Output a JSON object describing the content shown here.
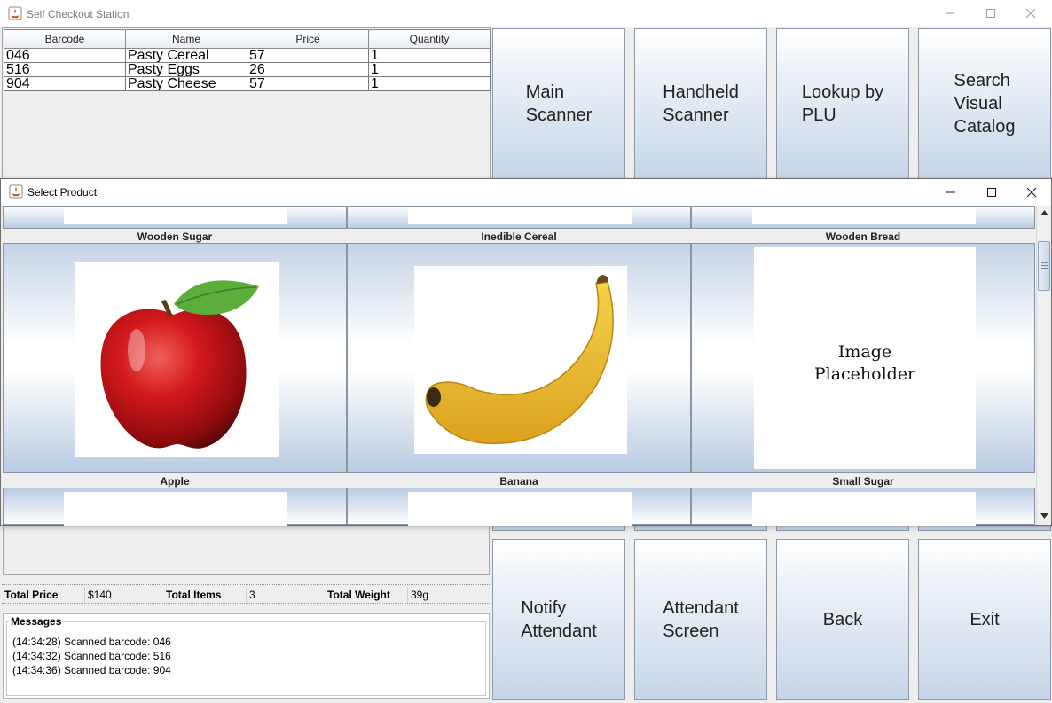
{
  "main_window": {
    "title": "Self Checkout Station",
    "cart": {
      "columns": [
        "Barcode",
        "Name",
        "Price",
        "Quantity"
      ],
      "rows": [
        {
          "barcode": "046",
          "name": "Pasty Cereal",
          "price": "57",
          "quantity": "1"
        },
        {
          "barcode": "516",
          "name": "Pasty Eggs",
          "price": "26",
          "quantity": "1"
        },
        {
          "barcode": "904",
          "name": "Pasty Cheese",
          "price": "57",
          "quantity": "1"
        }
      ]
    },
    "top_buttons": {
      "main_scanner": [
        "Main",
        "Scanner"
      ],
      "handheld_scanner": [
        "Handheld",
        "Scanner"
      ],
      "lookup_plu": [
        "Lookup by",
        "PLU"
      ],
      "search_catalog": [
        "Search",
        "Visual",
        "Catalog"
      ]
    },
    "totals": {
      "price_label": "Total Price",
      "price_value": "$140",
      "items_label": "Total Items",
      "items_value": "3",
      "weight_label": "Total Weight",
      "weight_value": "39g"
    },
    "messages": {
      "legend": "Messages",
      "lines": [
        "(14:34:28) Scanned barcode: 046",
        "(14:34:32) Scanned barcode: 516",
        "(14:34:36) Scanned barcode: 904"
      ]
    },
    "bottom_buttons": {
      "notify_attendant": [
        "Notify",
        "Attendant"
      ],
      "attendant_screen": [
        "Attendant",
        "Screen"
      ],
      "back": [
        "Back"
      ],
      "exit": [
        "Exit"
      ]
    }
  },
  "select_product_window": {
    "title": "Select Product",
    "upper_labels": [
      "Wooden Sugar",
      "Inedible Cereal",
      "Wooden Bread"
    ],
    "products": [
      {
        "name": "Apple",
        "image": "apple-image"
      },
      {
        "name": "Banana",
        "image": "banana-image"
      },
      {
        "name": "Small Sugar",
        "image": "placeholder",
        "placeholder_text": [
          "Image",
          "Placeholder"
        ]
      }
    ]
  },
  "colors": {
    "button_gradient_top": "#ffffff",
    "button_gradient_bottom": "#c6d6e8",
    "panel_bg": "#eeeeee"
  },
  "icons": [
    "java-app-icon",
    "minimize-icon",
    "maximize-icon",
    "close-icon",
    "scroll-up-icon",
    "scroll-down-icon"
  ]
}
